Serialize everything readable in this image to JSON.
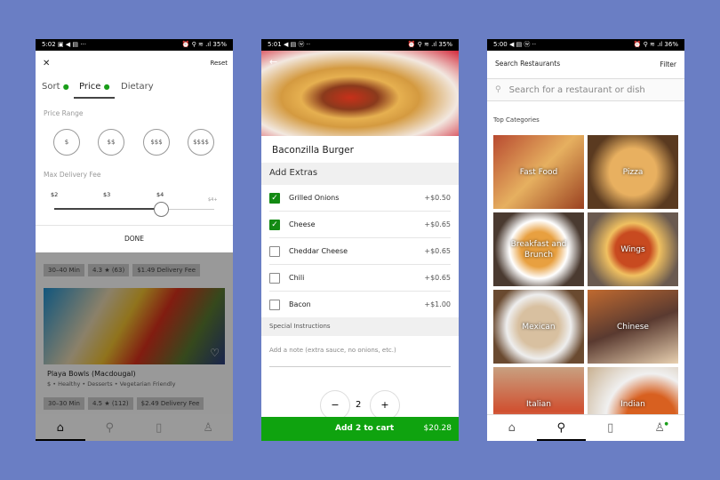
{
  "filter_screen": {
    "status": {
      "time": "5:02",
      "icons": "▣ ◀ ▤ ···",
      "right": "⏰ ⚲ ≋ .ıl 35%"
    },
    "close": "✕",
    "reset": "Reset",
    "tabs": [
      {
        "label": "Sort",
        "dot": true
      },
      {
        "label": "Price",
        "dot": true,
        "active": true
      },
      {
        "label": "Dietary",
        "dot": false
      }
    ],
    "price_range_label": "Price Range",
    "price_options": [
      "$",
      "$$",
      "$$$",
      "$$$$"
    ],
    "max_fee_label": "Max Delivery Fee",
    "fee_ticks": [
      "$2",
      "$3",
      "$4",
      "$4+"
    ],
    "fee_value": "$4",
    "done": "DONE",
    "bg_chips": [
      "30–40 Min",
      "4.3 ★ (63)",
      "$1.49 Delivery Fee"
    ],
    "restaurant": {
      "name": "Playa Bowls (Macdougal)",
      "tags": "$ • Healthy • Desserts • Vegetarian Friendly",
      "chips": [
        "30–30 Min",
        "4.5 ★ (112)",
        "$2.49 Delivery Fee"
      ]
    },
    "accent": "#1a9e1a"
  },
  "item_screen": {
    "status": {
      "time": "5:01",
      "icons": "◀ ▤ ⓦ ··",
      "right": "⏰ ⚲ ≋ .ıl 35%"
    },
    "back": "←",
    "title": "Baconzilla Burger",
    "extras_header": "Add Extras",
    "extras": [
      {
        "label": "Grilled Onions",
        "price": "+$0.50",
        "checked": true
      },
      {
        "label": "Cheese",
        "price": "+$0.65",
        "checked": true
      },
      {
        "label": "Cheddar Cheese",
        "price": "+$0.65",
        "checked": false
      },
      {
        "label": "Chili",
        "price": "+$0.65",
        "checked": false
      },
      {
        "label": "Bacon",
        "price": "+$1.00",
        "checked": false
      }
    ],
    "special_header": "Special Instructions",
    "note_placeholder": "Add a note (extra sauce, no onions, etc.)",
    "minus": "−",
    "qty": "2",
    "plus": "+",
    "cart_label": "Add 2 to cart",
    "cart_total": "$20.28",
    "cart_color": "#0fa30f"
  },
  "search_screen": {
    "status": {
      "time": "5:00",
      "icons": "◀ ▤ ⓦ ··",
      "right": "⏰ ⚲ ≋ .ıl 36%"
    },
    "title": "Search Restaurants",
    "filter": "Filter",
    "search_placeholder": "Search for a restaurant or dish",
    "section": "Top Categories",
    "categories": [
      "Fast Food",
      "Pizza",
      "Breakfast and Brunch",
      "Wings",
      "Mexican",
      "Chinese",
      "Italian",
      "Indian"
    ]
  },
  "nav_icons": [
    "home-icon",
    "search-icon",
    "orders-icon",
    "account-icon"
  ]
}
